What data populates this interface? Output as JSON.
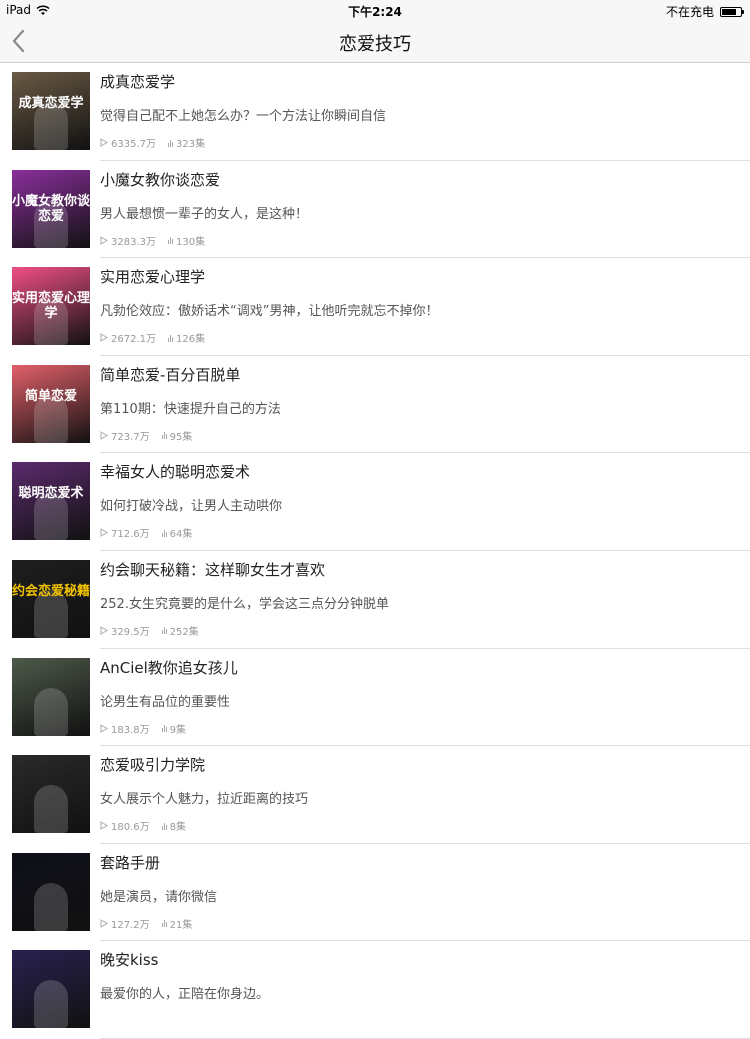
{
  "status_bar": {
    "device": "iPad",
    "time": "下午2:24",
    "charging": "不在充电",
    "battery_level": 0.8
  },
  "nav": {
    "title": "恋爱技巧"
  },
  "items": [
    {
      "title": "成真恋爱学",
      "desc": "觉得自己配不上她怎么办？一个方法让你瞬间自信",
      "plays": "6335.7万",
      "episodes": "323集",
      "cover_text": "成真恋爱学",
      "cover_bg": "#6b5a45",
      "cover_fg": "#ffffff"
    },
    {
      "title": "小魔女教你谈恋爱",
      "desc": "男人最想惯一辈子的女人，是这种！",
      "plays": "3283.3万",
      "episodes": "130集",
      "cover_text": "小魔女教你谈恋爱",
      "cover_bg": "#8a2f9c",
      "cover_fg": "#ffffff"
    },
    {
      "title": "实用恋爱心理学",
      "desc": "凡勃伦效应：傲娇话术“调戏”男神，让他听完就忘不掉你！",
      "plays": "2672.1万",
      "episodes": "126集",
      "cover_text": "实用恋爱心理学",
      "cover_bg": "#ef4f86",
      "cover_fg": "#ffffff"
    },
    {
      "title": "简单恋爱-百分百脱单",
      "desc": "第110期：快速提升自己的方法",
      "plays": "723.7万",
      "episodes": "95集",
      "cover_text": "简单恋爱",
      "cover_bg": "#e2606a",
      "cover_fg": "#ffffff"
    },
    {
      "title": "幸福女人的聪明恋爱术",
      "desc": "如何打破冷战，让男人主动哄你",
      "plays": "712.6万",
      "episodes": "64集",
      "cover_text": "聪明恋爱术",
      "cover_bg": "#5c2b6e",
      "cover_fg": "#ffffff"
    },
    {
      "title": "约会聊天秘籍：这样聊女生才喜欢",
      "desc": "252.女生究竟要的是什么，学会这三点分分钟脱单",
      "plays": "329.5万",
      "episodes": "252集",
      "cover_text": "约会恋爱秘籍",
      "cover_bg": "#1e1e1e",
      "cover_fg": "#f2c400"
    },
    {
      "title": "AnCiel教你追女孩儿",
      "desc": "论男生有品位的重要性",
      "plays": "183.8万",
      "episodes": "9集",
      "cover_text": "",
      "cover_bg": "#4e5a4a",
      "cover_fg": "#ffffff"
    },
    {
      "title": "恋爱吸引力学院",
      "desc": "女人展示个人魅力，拉近距离的技巧",
      "plays": "180.6万",
      "episodes": "8集",
      "cover_text": "",
      "cover_bg": "#2a2a2a",
      "cover_fg": "#ffffff"
    },
    {
      "title": "套路手册",
      "desc": "她是演员，请你微信",
      "plays": "127.2万",
      "episodes": "21集",
      "cover_text": "",
      "cover_bg": "#0f0f1a",
      "cover_fg": "#d9a850"
    },
    {
      "title": "晚安kiss",
      "desc": "最爱你的人，正陪在你身边。",
      "plays": "",
      "episodes": "",
      "cover_text": "",
      "cover_bg": "#2a2150",
      "cover_fg": "#ffffff"
    }
  ]
}
